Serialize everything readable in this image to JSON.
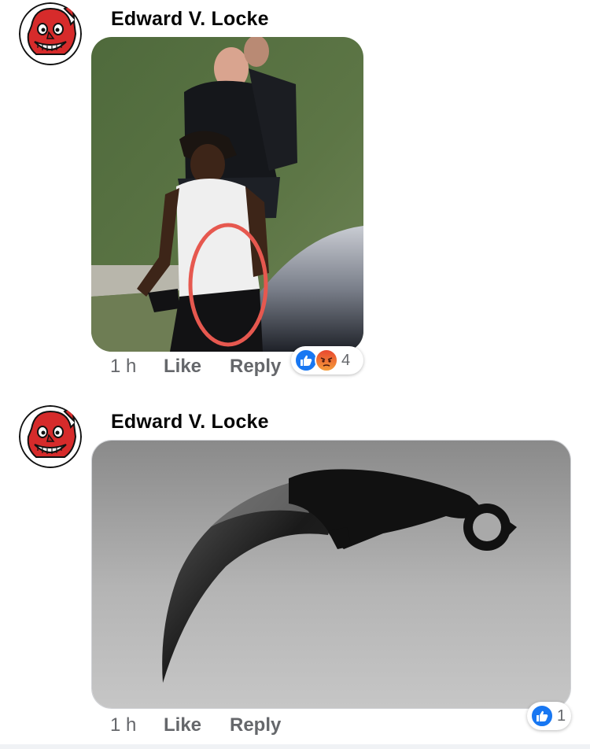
{
  "comments": [
    {
      "author": "Edward V. Locke",
      "time": "1 h",
      "like_label": "Like",
      "reply_label": "Reply",
      "reaction_count": "4",
      "reactions": [
        "like-icon",
        "angry-icon"
      ]
    },
    {
      "author": "Edward V. Locke",
      "time": "1 h",
      "like_label": "Like",
      "reply_label": "Reply",
      "reaction_count": "1",
      "reactions": [
        "like-icon"
      ]
    }
  ],
  "colors": {
    "like_blue": "#1877f2",
    "angry_orange": "#f0703a",
    "meta_gray": "#65676b"
  }
}
